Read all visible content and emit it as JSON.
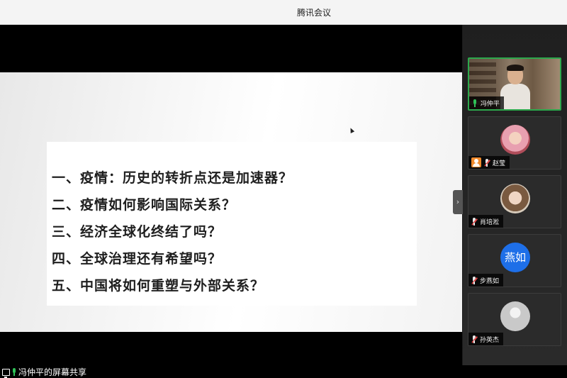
{
  "window": {
    "title": "腾讯会议"
  },
  "slide": {
    "lines": [
      "一、疫情：历史的转折点还是加速器？",
      "二、疫情如何影响国际关系？",
      "三、经济全球化终结了吗？",
      "四、全球治理还有希望吗？",
      "五、中国将如何重塑与外部关系？"
    ]
  },
  "share_status": {
    "text": "冯仲平的屏幕共享"
  },
  "participants": [
    {
      "name": "冯仲平",
      "initials": "",
      "mic": "on",
      "speaking": true,
      "host": false
    },
    {
      "name": "赵莹",
      "initials": "",
      "mic": "muted",
      "speaking": false,
      "host": true
    },
    {
      "name": "肖培淞",
      "initials": "",
      "mic": "muted",
      "speaking": false,
      "host": false
    },
    {
      "name": "步燕如",
      "initials": "燕如",
      "mic": "muted",
      "speaking": false,
      "host": false
    },
    {
      "name": "孙英杰",
      "initials": "",
      "mic": "muted",
      "speaking": false,
      "host": false
    }
  ],
  "colors": {
    "speaking_border": "#2ca84c",
    "initials_avatar": "#1e6fe8",
    "host_badge": "#f08a2c"
  }
}
